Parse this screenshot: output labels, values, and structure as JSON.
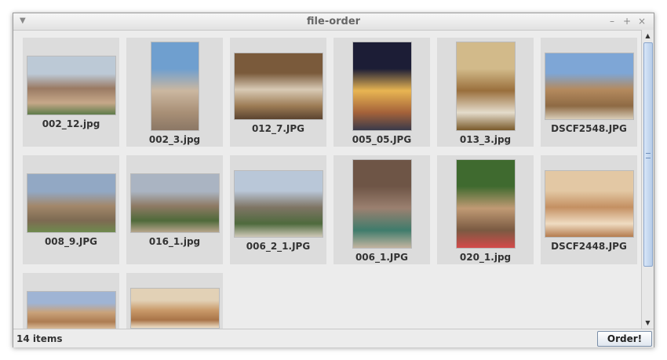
{
  "window": {
    "title": "file-order",
    "menu_icon": "dropdown-triangle-icon",
    "controls": [
      {
        "name": "minimize-button",
        "glyph": "–"
      },
      {
        "name": "maximize-button",
        "glyph": "+"
      },
      {
        "name": "close-button",
        "glyph": "×"
      }
    ]
  },
  "colors": {
    "tile_bg": "#dcdcdc",
    "window_bg": "#ececec",
    "scroll_thumb": "#b7cde9"
  },
  "files": [
    {
      "name": "002_12.jpg",
      "icon": "arched-courtyard-photo-icon",
      "colors": [
        "#bcc9d6",
        "#9a7a63",
        "#c6a889",
        "#5e7b4a"
      ]
    },
    {
      "name": "002_3.jpg",
      "icon": "minaret-arch-photo-icon",
      "colors": [
        "#6f9fcf",
        "#cbb7a0",
        "#a88f76",
        "#8b7765"
      ]
    },
    {
      "name": "012_7.JPG",
      "icon": "mosque-hall-photo-icon",
      "colors": [
        "#7a5a3b",
        "#d8cab5",
        "#9c7b54",
        "#5b4330"
      ]
    },
    {
      "name": "005_05.JPG",
      "icon": "illuminated-gate-photo-icon",
      "colors": [
        "#1c1d36",
        "#e8b552",
        "#a4623a",
        "#3a3a4a"
      ]
    },
    {
      "name": "013_3.jpg",
      "icon": "spice-sacks-photo-icon",
      "colors": [
        "#d2ba8a",
        "#9a6f3c",
        "#e4dccb",
        "#7a5a2a"
      ]
    },
    {
      "name": "DSCF2548.JPG",
      "icon": "ruined-fort-photo-icon",
      "colors": [
        "#7ea6d6",
        "#b48a5e",
        "#8e6a44",
        "#d8cdb8"
      ]
    },
    {
      "name": "008_9.JPG",
      "icon": "stone-fort-photo-icon",
      "colors": [
        "#92a8c4",
        "#a2876a",
        "#7d6a52",
        "#6f8a4e"
      ]
    },
    {
      "name": "016_1.jpg",
      "icon": "village-hillside-photo-icon",
      "colors": [
        "#aab4c2",
        "#8e7a64",
        "#4f6a3a",
        "#b7a58c"
      ]
    },
    {
      "name": "006_2_1.JPG",
      "icon": "rocky-valley-photo-icon",
      "colors": [
        "#b9c7d8",
        "#7f7565",
        "#4e6a3d",
        "#cfc8b8"
      ]
    },
    {
      "name": "006_1.JPG",
      "icon": "canyon-stream-photo-icon",
      "colors": [
        "#6e5546",
        "#9b8070",
        "#3f7c6c",
        "#c2b4a0"
      ]
    },
    {
      "name": "020_1.jpg",
      "icon": "camel-portrait-photo-icon",
      "colors": [
        "#3f6a2f",
        "#c09a74",
        "#7a5a42",
        "#d44a4a"
      ]
    },
    {
      "name": "DSCF2448.JPG",
      "icon": "sand-dunes-photo-icon",
      "colors": [
        "#e3c8a4",
        "#c49062",
        "#efdcc2",
        "#b47b4e"
      ]
    },
    {
      "name": "",
      "icon": "desert-horizon-photo-icon",
      "colors": [
        "#9fb4d4",
        "#c9a27a",
        "#ad7c52",
        "#ddc2a0"
      ]
    },
    {
      "name": "",
      "icon": "dune-ridges-photo-icon",
      "colors": [
        "#e2d1b6",
        "#c99a6a",
        "#a97448",
        "#efe0c8"
      ]
    }
  ],
  "status": {
    "count_text": "14 items",
    "order_button": "Order!"
  },
  "scrollbar": {
    "up_icon": "scroll-up-arrow-icon",
    "down_icon": "scroll-down-arrow-icon",
    "position_fraction": 0.0,
    "visible_fraction": 0.75
  }
}
